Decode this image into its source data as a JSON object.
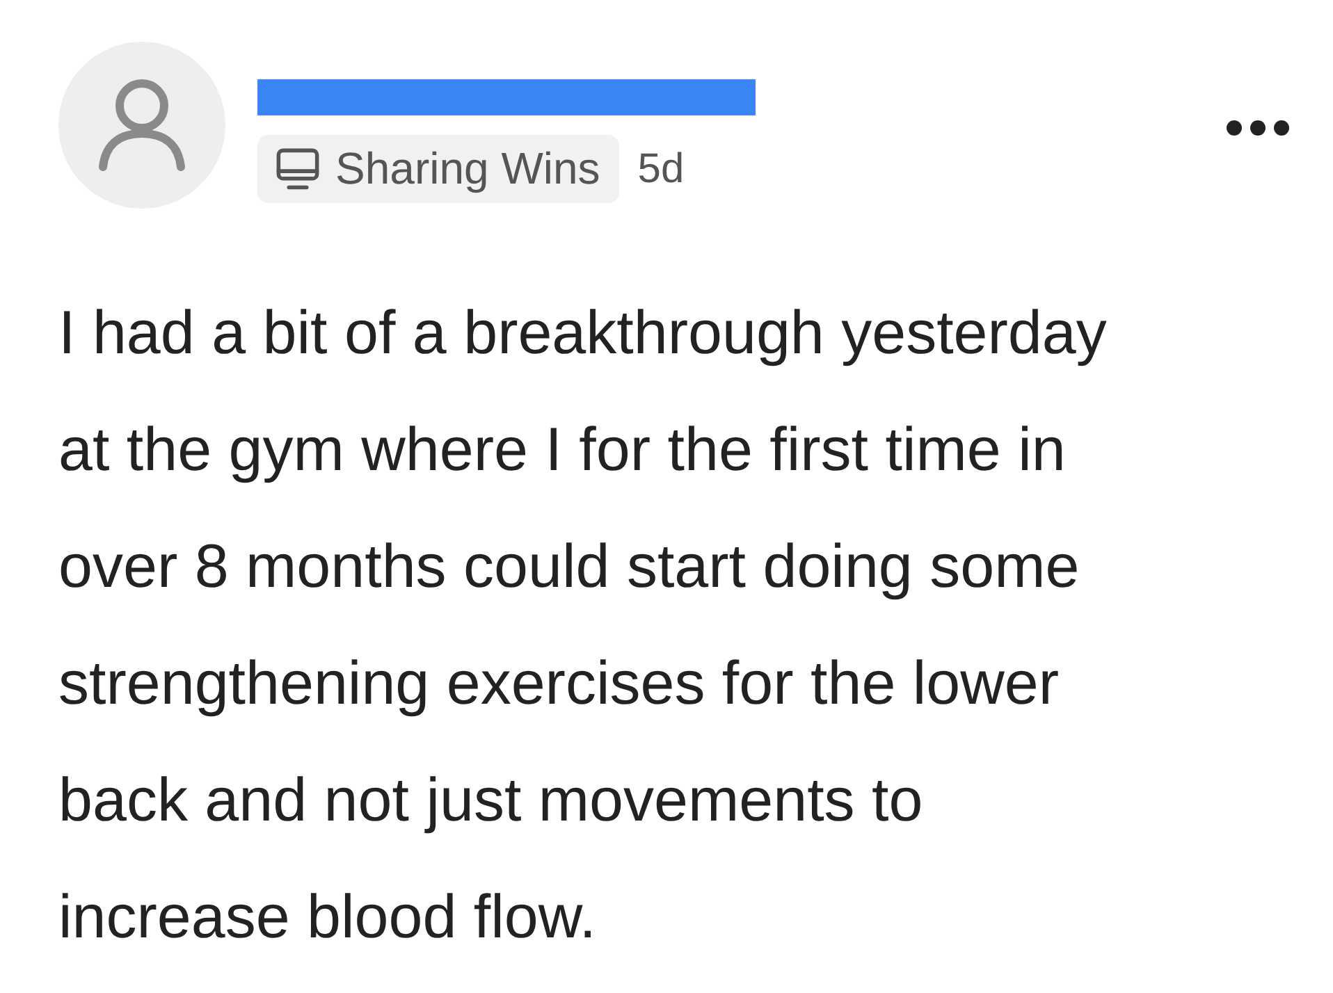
{
  "post": {
    "author_redacted": true,
    "community": "Sharing Wins",
    "age": "5d",
    "body": "I had a bit of a breakthrough yesterday at the gym where I for the first time in over 8 months could start doing some strengthening exercises for the lower back and not just movements to increase blood flow."
  }
}
